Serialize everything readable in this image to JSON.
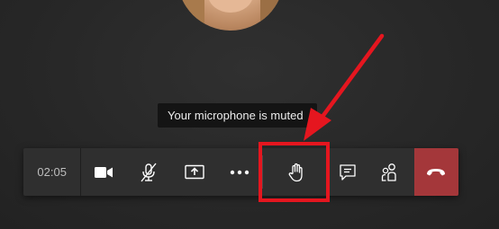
{
  "tooltip": {
    "text": "Your microphone is muted"
  },
  "toolbar": {
    "timer": "02:05",
    "buttons": [
      {
        "name": "camera",
        "icon": "video-camera-icon"
      },
      {
        "name": "microphone",
        "icon": "microphone-muted-icon"
      },
      {
        "name": "share",
        "icon": "share-screen-icon"
      },
      {
        "name": "more",
        "icon": "more-options-icon"
      },
      {
        "name": "raise-hand",
        "icon": "hand-icon"
      },
      {
        "name": "chat",
        "icon": "chat-icon"
      },
      {
        "name": "participants",
        "icon": "participants-icon"
      },
      {
        "name": "hang-up",
        "icon": "phone-hangup-icon"
      }
    ]
  },
  "colors": {
    "background": "#262626",
    "toolbar": "#2f2f2f",
    "hangup": "#a4373a",
    "annotation": "#e5161f"
  }
}
